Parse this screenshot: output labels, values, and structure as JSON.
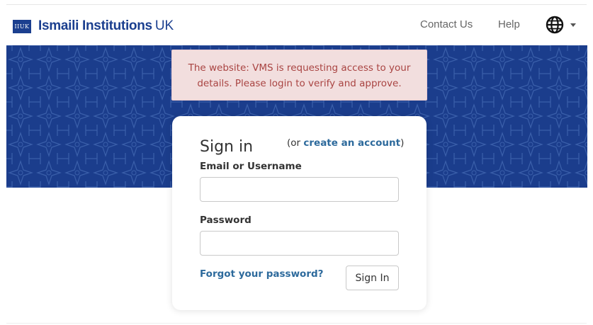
{
  "header": {
    "logo_text": "IIUK",
    "brand_name": "Ismaili Institutions",
    "brand_suffix": "UK",
    "nav": {
      "contact": "Contact Us",
      "help": "Help"
    },
    "language_icon": "globe-icon",
    "dropdown_icon": "caret-down-icon"
  },
  "banner": {
    "color": "#1b3d8c"
  },
  "alert": {
    "line1": "The website: VMS is requesting access to your",
    "line2": "details. Please login to verify and approve.",
    "background": "#f2dede",
    "text_color": "#a94442"
  },
  "signin": {
    "title": "Sign in",
    "create_prefix": "(or ",
    "create_link": "create an account",
    "create_suffix": ")",
    "email_label": "Email or Username",
    "email_value": "",
    "password_label": "Password",
    "password_value": "",
    "forgot_link": "Forgot your password?",
    "submit_label": "Sign In",
    "link_color": "#2d6a9c"
  }
}
